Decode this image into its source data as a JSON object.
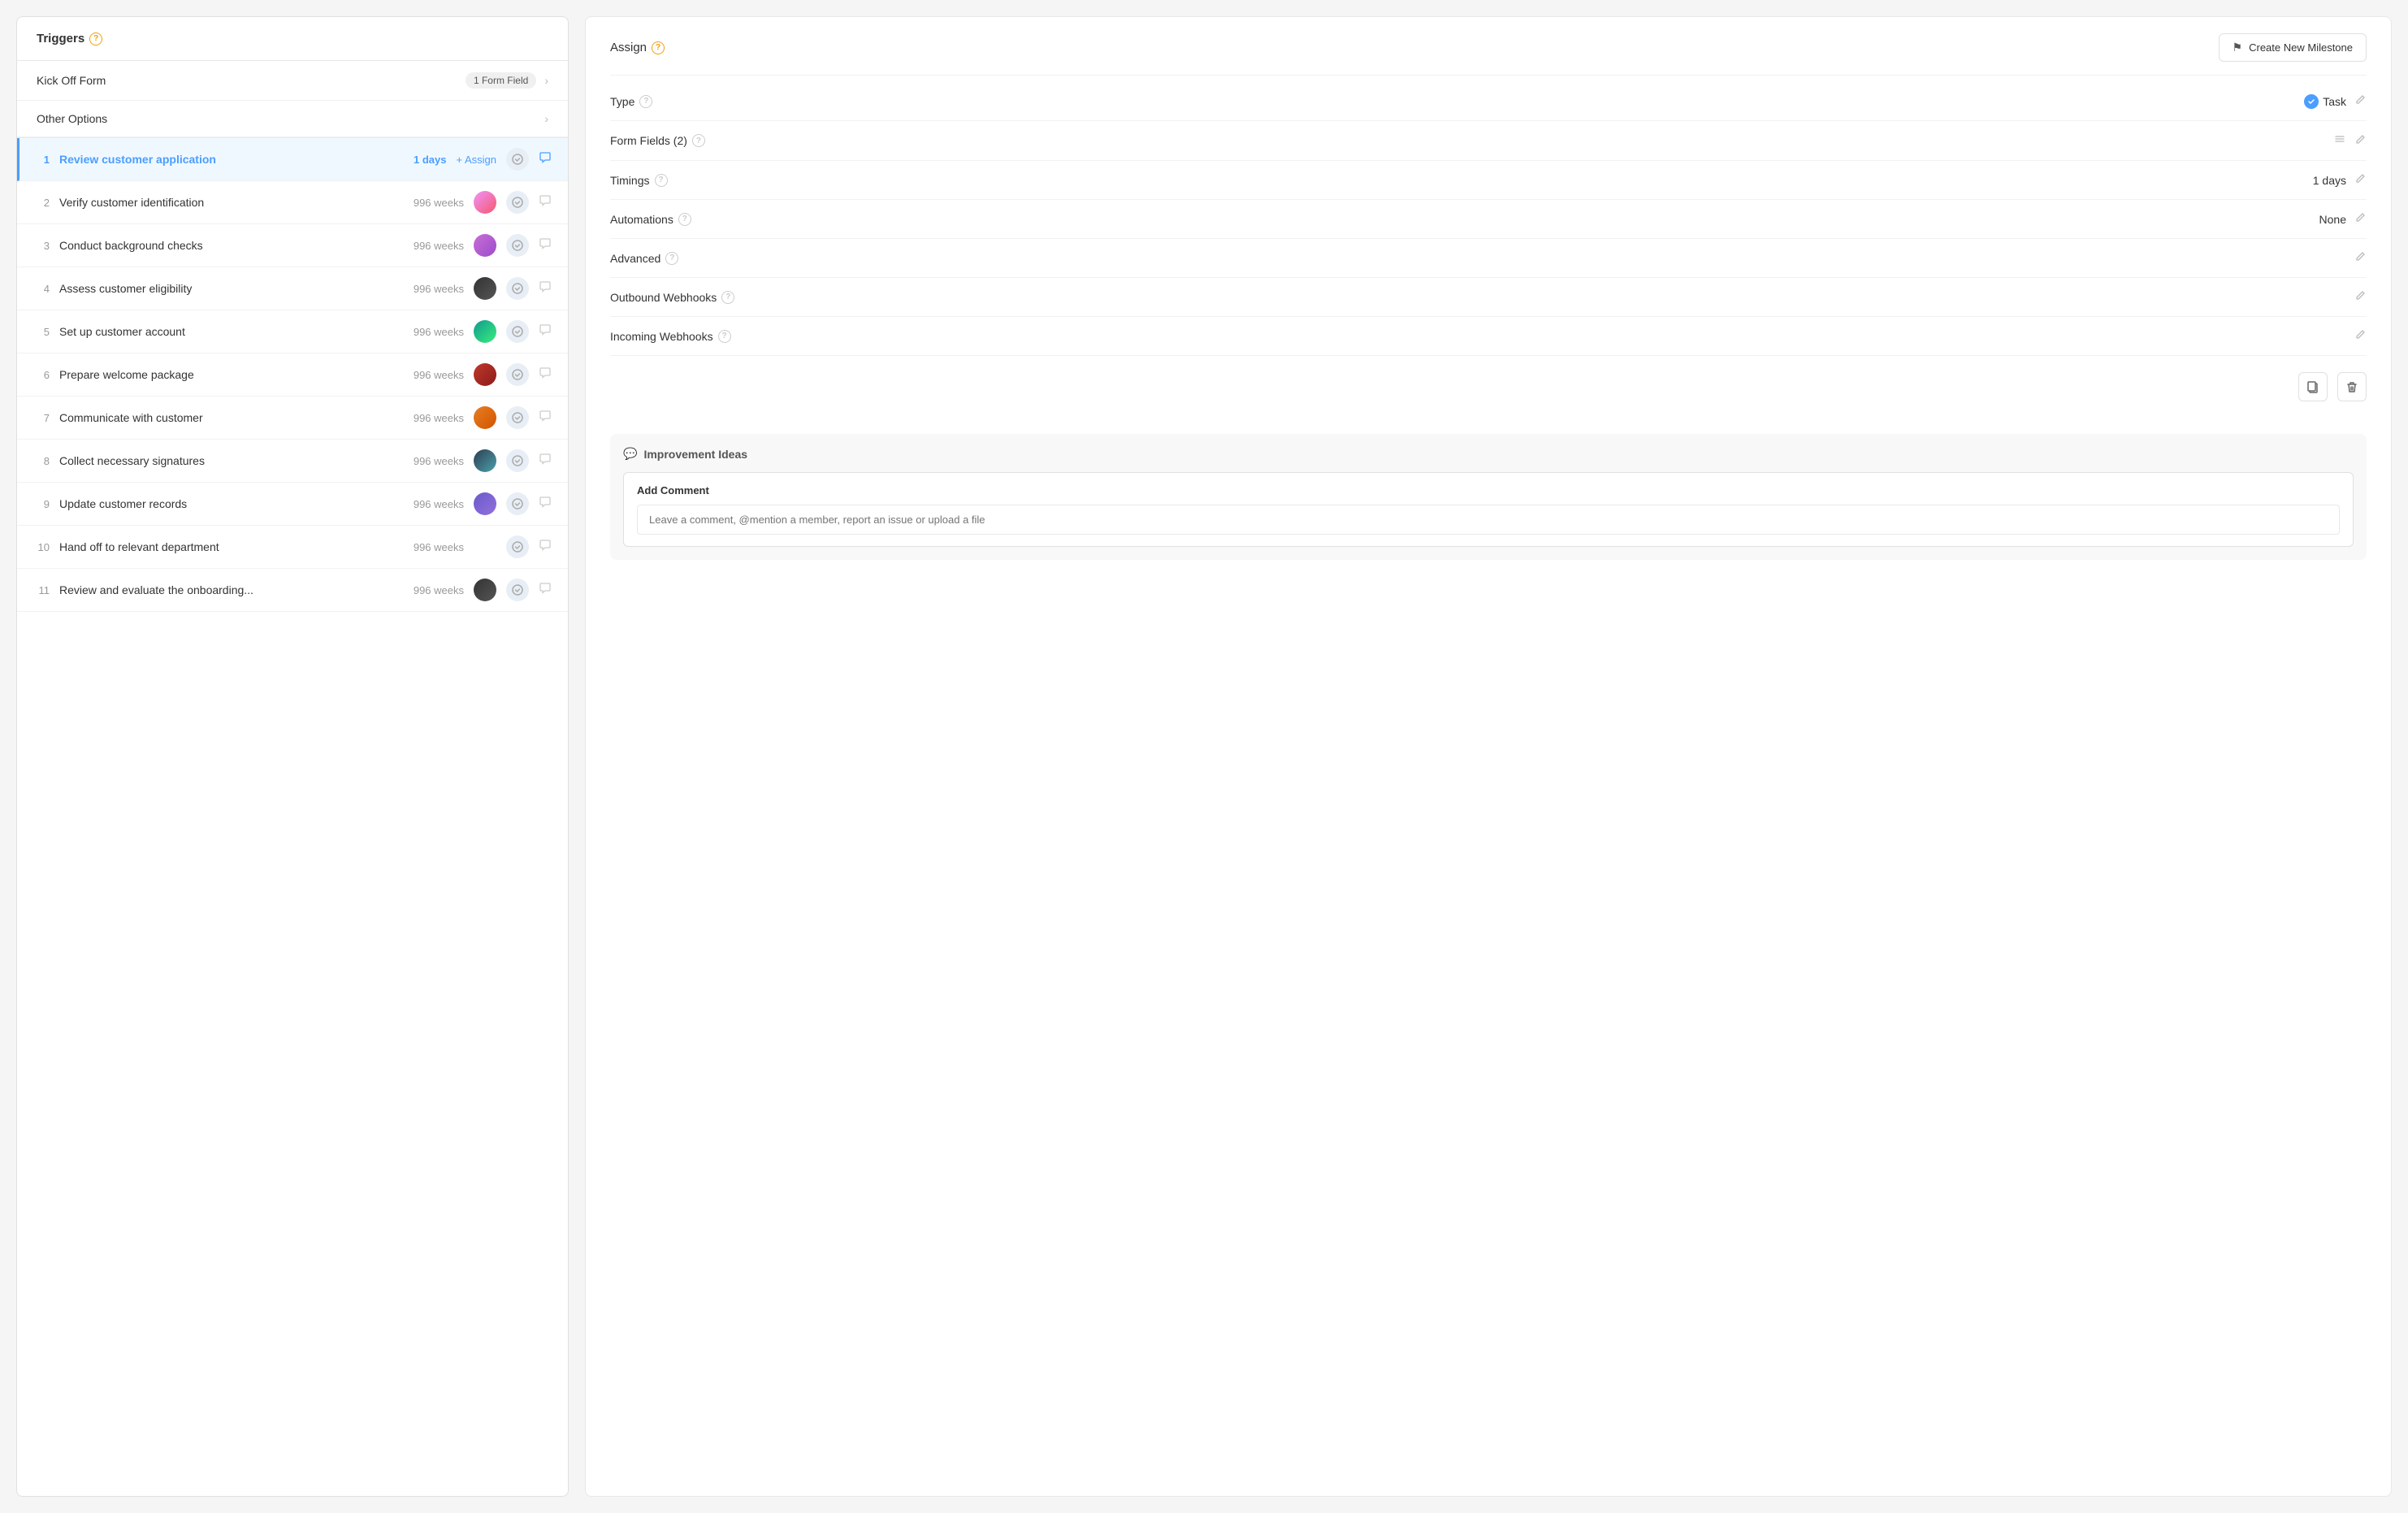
{
  "leftPanel": {
    "triggers": {
      "label": "Triggers",
      "items": [
        {
          "name": "Kick Off Form",
          "badge": "1 Form Field",
          "hasChevron": true
        },
        {
          "name": "Other Options",
          "badge": null,
          "hasChevron": true
        }
      ]
    },
    "tasks": [
      {
        "id": 1,
        "name": "Review customer application",
        "duration": "1 days",
        "hasAvatar": false,
        "avatarClass": "",
        "active": true
      },
      {
        "id": 2,
        "name": "Verify customer identification",
        "duration": "996 weeks",
        "hasAvatar": true,
        "avatarClass": "avatar-1",
        "active": false
      },
      {
        "id": 3,
        "name": "Conduct background checks",
        "duration": "996 weeks",
        "hasAvatar": true,
        "avatarClass": "avatar-2",
        "active": false
      },
      {
        "id": 4,
        "name": "Assess customer eligibility",
        "duration": "996 weeks",
        "hasAvatar": true,
        "avatarClass": "avatar-3",
        "active": false
      },
      {
        "id": 5,
        "name": "Set up customer account",
        "duration": "996 weeks",
        "hasAvatar": true,
        "avatarClass": "avatar-4",
        "active": false
      },
      {
        "id": 6,
        "name": "Prepare welcome package",
        "duration": "996 weeks",
        "hasAvatar": true,
        "avatarClass": "avatar-5",
        "active": false
      },
      {
        "id": 7,
        "name": "Communicate with customer",
        "duration": "996 weeks",
        "hasAvatar": true,
        "avatarClass": "avatar-6",
        "active": false
      },
      {
        "id": 8,
        "name": "Collect necessary signatures",
        "duration": "996 weeks",
        "hasAvatar": true,
        "avatarClass": "avatar-7",
        "active": false
      },
      {
        "id": 9,
        "name": "Update customer records",
        "duration": "996 weeks",
        "hasAvatar": true,
        "avatarClass": "avatar-8",
        "active": false
      },
      {
        "id": 10,
        "name": "Hand off to relevant department",
        "duration": "996 weeks",
        "hasAvatar": false,
        "avatarClass": "",
        "active": false
      },
      {
        "id": 11,
        "name": "Review and evaluate the onboarding...",
        "duration": "996 weeks",
        "hasAvatar": true,
        "avatarClass": "avatar-3",
        "active": false
      }
    ]
  },
  "rightPanel": {
    "header": {
      "assignLabel": "Assign",
      "createMilestoneLabel": "Create New Milestone"
    },
    "details": [
      {
        "label": "Type",
        "value": "Task",
        "valueType": "badge",
        "hasListIcon": false,
        "hasEditIcon": true
      },
      {
        "label": "Form Fields (2)",
        "value": "",
        "valueType": "icons",
        "hasListIcon": true,
        "hasEditIcon": true
      },
      {
        "label": "Timings",
        "value": "1 days",
        "valueType": "duration",
        "hasListIcon": false,
        "hasEditIcon": true
      },
      {
        "label": "Automations",
        "value": "None",
        "valueType": "text",
        "hasListIcon": false,
        "hasEditIcon": true
      },
      {
        "label": "Advanced",
        "value": "",
        "valueType": "empty",
        "hasListIcon": false,
        "hasEditIcon": true
      },
      {
        "label": "Outbound Webhooks",
        "value": "",
        "valueType": "empty",
        "hasListIcon": false,
        "hasEditIcon": true
      },
      {
        "label": "Incoming Webhooks",
        "value": "",
        "valueType": "empty",
        "hasListIcon": false,
        "hasEditIcon": true
      }
    ],
    "commentSection": {
      "title": "Improvement Ideas",
      "addComment": {
        "title": "Add Comment",
        "placeholder": "Leave a comment, @mention a member, report an issue or upload a file"
      }
    }
  }
}
